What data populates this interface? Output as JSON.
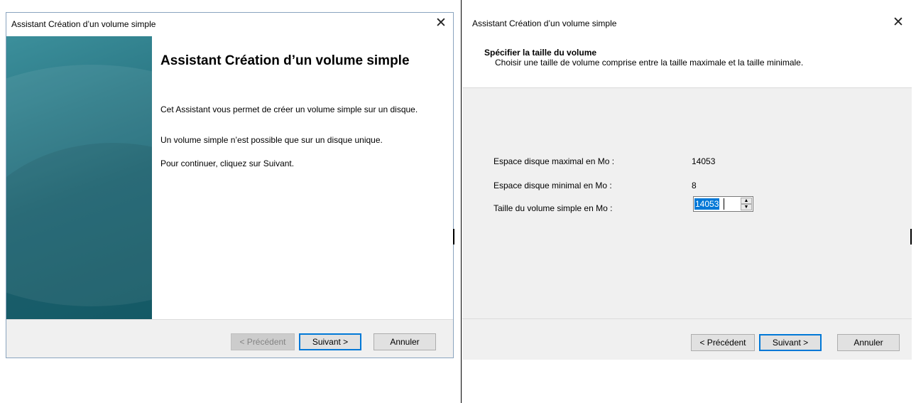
{
  "left_wizard": {
    "title": "Assistant Création d’un volume simple",
    "close_glyph": "✕",
    "heading": "Assistant Création d’un volume simple",
    "paragraphs": [
      "Cet Assistant vous permet de créer un volume simple sur un disque.",
      "Un volume simple n’est possible que sur un disque unique.",
      "Pour continuer, cliquez sur Suivant."
    ],
    "buttons": {
      "back": "< Précédent",
      "next": "Suivant >",
      "cancel": "Annuler"
    }
  },
  "right_wizard": {
    "title": "Assistant Création d’un volume simple",
    "close_glyph": "✕",
    "header": {
      "title": "Spécifier la taille du volume",
      "subtitle": "Choisir une taille de volume comprise entre la taille maximale et la taille minimale."
    },
    "fields": [
      {
        "label": "Espace disque maximal en Mo :",
        "value": "14053"
      },
      {
        "label": "Espace disque minimal en Mo :",
        "value": "8"
      },
      {
        "label": "Taille du volume simple en Mo :",
        "value": "14053"
      }
    ],
    "spin_up_glyph": "▲",
    "spin_down_glyph": "▼",
    "buttons": {
      "back": "< Précédent",
      "next": "Suivant >",
      "cancel": "Annuler"
    }
  },
  "colors": {
    "accent": "#0078d7",
    "sidebar": "#1f6a78",
    "footer": "#f0f0f0"
  }
}
